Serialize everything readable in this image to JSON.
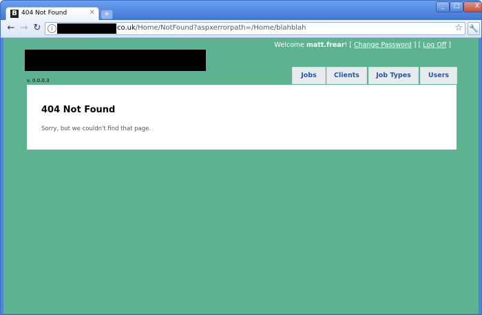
{
  "browser": {
    "tab_title": "404 Not Found",
    "tab_favicon_letter": "B",
    "new_tab_label": "+",
    "window_buttons": {
      "minimize": "_",
      "maximize": "□",
      "close": "X"
    },
    "url_host_suffix": "co.uk",
    "url_path": "/Home/NotFound?aspxerrorpath=/Home/blahblah"
  },
  "header": {
    "welcome_prefix": "Welcome",
    "username": "matt.frear",
    "welcome_suffix": "! [",
    "change_password": "Change Password",
    "separator": "] [",
    "log_off": "Log Off",
    "closing_bracket": "]",
    "version": "v. 0.0.0.3"
  },
  "menu": {
    "items": [
      {
        "label": "Jobs"
      },
      {
        "label": "Clients"
      },
      {
        "label": "Job Types"
      },
      {
        "label": "Users"
      }
    ]
  },
  "main": {
    "heading": "404 Not Found",
    "message": "Sorry, but we couldn't find that page."
  },
  "colors": {
    "page_background": "#5cb291",
    "menu_text": "#2455b8",
    "content_background": "#ffffff"
  }
}
